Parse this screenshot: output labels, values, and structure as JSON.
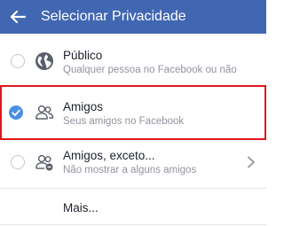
{
  "header": {
    "title": "Selecionar Privacidade"
  },
  "options": [
    {
      "title": "Público",
      "subtitle": "Qualquer pessoa no Facebook ou não",
      "icon": "globe-icon",
      "selected": false
    },
    {
      "title": "Amigos",
      "subtitle": "Seus amigos no Facebook",
      "icon": "friends-icon",
      "selected": true
    },
    {
      "title": "Amigos, exceto...",
      "subtitle": "Não mostrar a alguns amigos",
      "icon": "friends-except-icon",
      "selected": false
    },
    {
      "title": "Mais...",
      "icon": "none",
      "selected": false
    }
  ],
  "colors": {
    "header": "#4267b2",
    "selected_radio": "#4a90e2",
    "highlight_border": "#e0161c"
  }
}
